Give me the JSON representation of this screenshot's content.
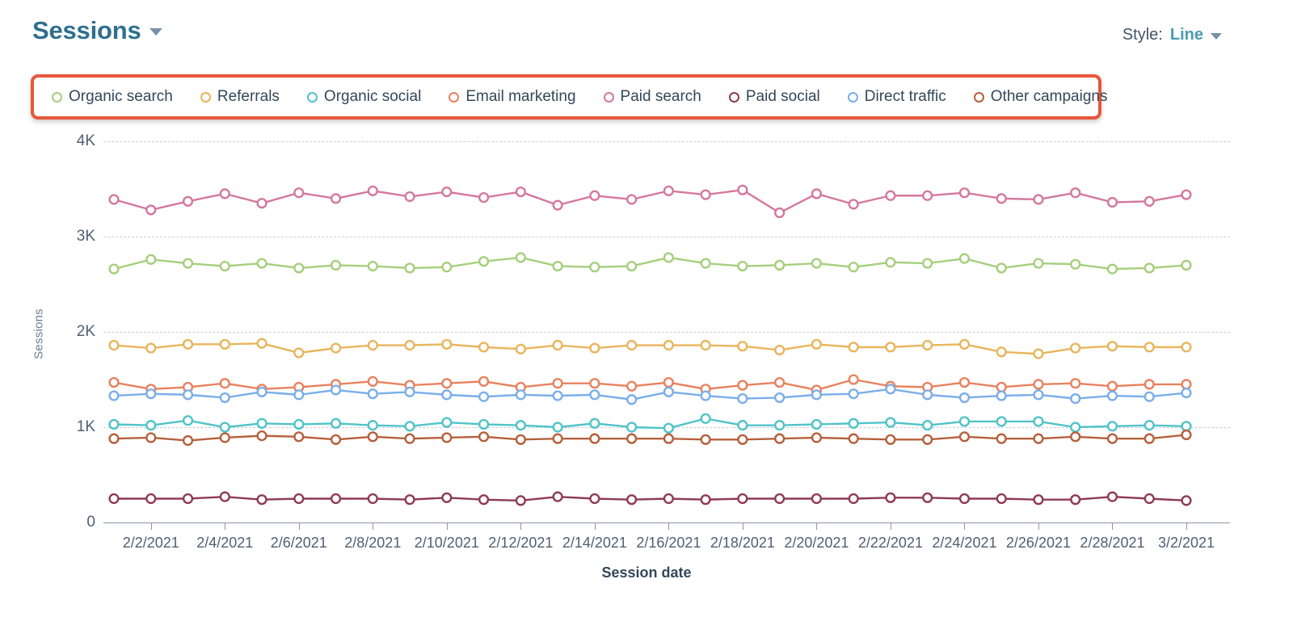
{
  "header": {
    "title": "Sessions",
    "title_caret_icon": "chevron-down-icon",
    "style_label": "Style:",
    "style_value": "Line",
    "style_caret_icon": "chevron-down-icon"
  },
  "legend": {
    "highlight_color": "#e8563c",
    "items": [
      {
        "label": "Organic search",
        "color": "#a5cf7d"
      },
      {
        "label": "Referrals",
        "color": "#e8b55c"
      },
      {
        "label": "Organic social",
        "color": "#4fc3c9"
      },
      {
        "label": "Email marketing",
        "color": "#e8815e"
      },
      {
        "label": "Paid search",
        "color": "#d4789b"
      },
      {
        "label": "Paid social",
        "color": "#8e3a55"
      },
      {
        "label": "Direct traffic",
        "color": "#7aaeea"
      },
      {
        "label": "Other campaigns",
        "color": "#b5603c"
      }
    ]
  },
  "chart_data": {
    "type": "line",
    "title": "Sessions",
    "xlabel": "Session date",
    "ylabel": "Sessions",
    "ylim": [
      0,
      4000
    ],
    "yticks": [
      0,
      1000,
      2000,
      3000,
      4000
    ],
    "ytick_labels": [
      "0",
      "1K",
      "2K",
      "3K",
      "4K"
    ],
    "grid": "horizontal-dashed",
    "legend_position": "top",
    "markers": "open-circle",
    "x": [
      "2/1/2021",
      "2/2/2021",
      "2/3/2021",
      "2/4/2021",
      "2/5/2021",
      "2/6/2021",
      "2/7/2021",
      "2/8/2021",
      "2/9/2021",
      "2/10/2021",
      "2/11/2021",
      "2/12/2021",
      "2/13/2021",
      "2/14/2021",
      "2/15/2021",
      "2/16/2021",
      "2/17/2021",
      "2/18/2021",
      "2/19/2021",
      "2/20/2021",
      "2/21/2021",
      "2/22/2021",
      "2/23/2021",
      "2/24/2021",
      "2/25/2021",
      "2/26/2021",
      "2/27/2021",
      "2/28/2021",
      "3/1/2021",
      "3/2/2021"
    ],
    "xtick_labels": [
      "2/2/2021",
      "2/4/2021",
      "2/6/2021",
      "2/8/2021",
      "2/10/2021",
      "2/12/2021",
      "2/14/2021",
      "2/16/2021",
      "2/18/2021",
      "2/20/2021",
      "2/22/2021",
      "2/24/2021",
      "2/26/2021",
      "2/28/2021",
      "3/2/2021"
    ],
    "series": [
      {
        "name": "Paid search",
        "color": "#d4789b",
        "values": [
          3390,
          3280,
          3370,
          3450,
          3350,
          3460,
          3400,
          3480,
          3420,
          3470,
          3410,
          3470,
          3330,
          3430,
          3390,
          3480,
          3440,
          3490,
          3250,
          3450,
          3340,
          3430,
          3430,
          3460,
          3400,
          3390,
          3460,
          3360,
          3370,
          3440
        ]
      },
      {
        "name": "Organic search",
        "color": "#a5cf7d",
        "values": [
          2660,
          2760,
          2720,
          2690,
          2720,
          2670,
          2700,
          2690,
          2670,
          2680,
          2740,
          2780,
          2690,
          2680,
          2690,
          2780,
          2720,
          2690,
          2700,
          2720,
          2680,
          2730,
          2720,
          2770,
          2670,
          2720,
          2710,
          2660,
          2670,
          2700
        ]
      },
      {
        "name": "Referrals",
        "color": "#e8b55c",
        "values": [
          1860,
          1830,
          1870,
          1870,
          1880,
          1780,
          1830,
          1860,
          1860,
          1870,
          1840,
          1820,
          1860,
          1830,
          1860,
          1860,
          1860,
          1850,
          1810,
          1870,
          1840,
          1840,
          1860,
          1870,
          1790,
          1770,
          1830,
          1850,
          1840,
          1840
        ]
      },
      {
        "name": "Email marketing",
        "color": "#e8815e",
        "values": [
          1470,
          1400,
          1420,
          1460,
          1400,
          1420,
          1450,
          1480,
          1440,
          1460,
          1480,
          1420,
          1460,
          1460,
          1430,
          1470,
          1400,
          1440,
          1470,
          1390,
          1500,
          1430,
          1420,
          1470,
          1420,
          1450,
          1460,
          1430,
          1450,
          1450
        ]
      },
      {
        "name": "Direct traffic",
        "color": "#7aaeea",
        "values": [
          1330,
          1350,
          1340,
          1310,
          1370,
          1340,
          1390,
          1350,
          1370,
          1340,
          1320,
          1340,
          1330,
          1340,
          1290,
          1370,
          1330,
          1300,
          1310,
          1340,
          1350,
          1400,
          1340,
          1310,
          1330,
          1340,
          1300,
          1330,
          1320,
          1360
        ]
      },
      {
        "name": "Organic social",
        "color": "#4fc3c9",
        "values": [
          1030,
          1020,
          1070,
          1000,
          1040,
          1030,
          1040,
          1020,
          1010,
          1050,
          1030,
          1020,
          1000,
          1040,
          1000,
          990,
          1090,
          1020,
          1020,
          1030,
          1040,
          1050,
          1020,
          1060,
          1060,
          1060,
          1000,
          1010,
          1020,
          1010
        ]
      },
      {
        "name": "Other campaigns",
        "color": "#b5603c",
        "values": [
          880,
          890,
          860,
          890,
          910,
          900,
          870,
          900,
          880,
          890,
          900,
          870,
          880,
          880,
          880,
          880,
          870,
          870,
          880,
          890,
          880,
          870,
          870,
          900,
          880,
          880,
          900,
          880,
          880,
          920
        ]
      },
      {
        "name": "Paid social",
        "color": "#8e3a55",
        "values": [
          250,
          250,
          250,
          270,
          240,
          250,
          250,
          250,
          240,
          260,
          240,
          230,
          270,
          250,
          240,
          250,
          240,
          250,
          250,
          250,
          250,
          260,
          260,
          250,
          250,
          240,
          240,
          270,
          250,
          230
        ]
      }
    ]
  }
}
